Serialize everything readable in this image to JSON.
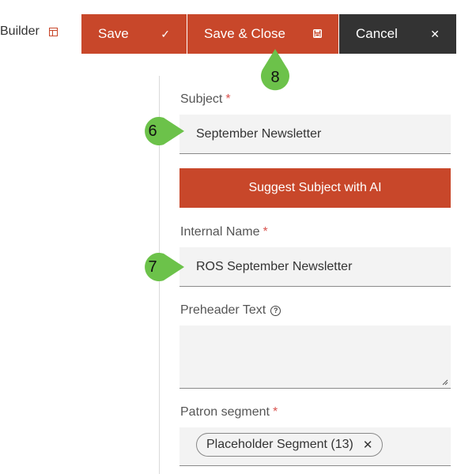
{
  "header": {
    "builder_label": "Builder",
    "builder_icon": "layout-icon"
  },
  "toolbar": {
    "save_label": "Save",
    "save_icon": "check-icon",
    "save_close_label": "Save & Close",
    "save_close_icon": "floppy-disk-icon",
    "cancel_label": "Cancel",
    "cancel_icon": "close-icon"
  },
  "form": {
    "subject": {
      "label": "Subject",
      "required_mark": "*",
      "value": "September Newsletter"
    },
    "suggest_button_label": "Suggest Subject with AI",
    "internal_name": {
      "label": "Internal Name",
      "required_mark": "*",
      "value": "ROS September Newsletter"
    },
    "preheader": {
      "label": "Preheader Text",
      "value": ""
    },
    "patron_segment": {
      "label": "Patron segment",
      "required_mark": "*",
      "chip_label": "Placeholder Segment (13)"
    }
  },
  "annotations": {
    "marker_8": "8",
    "marker_6": "6",
    "marker_7": "7"
  },
  "colors": {
    "accent": "#c8472a",
    "dark": "#333333",
    "marker": "#6cc24a"
  }
}
